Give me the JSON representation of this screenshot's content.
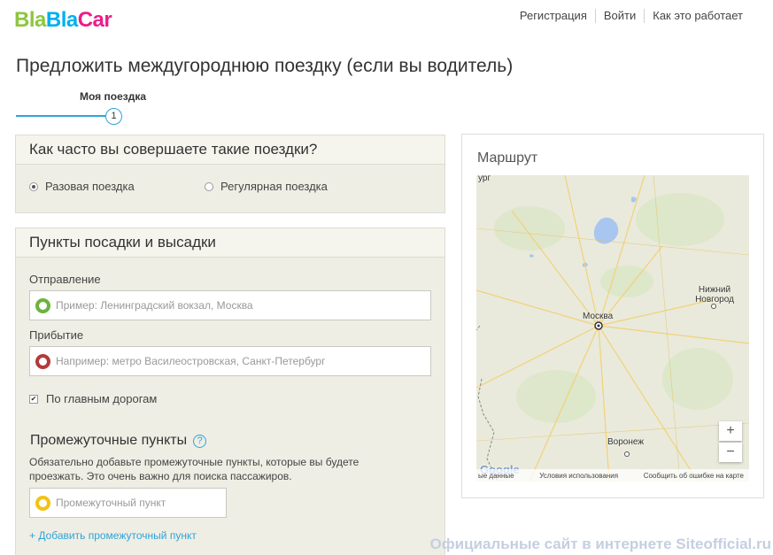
{
  "logo": {
    "part1": "Bla",
    "part2": "Bla",
    "part3": "Car"
  },
  "nav": {
    "register": "Регистрация",
    "login": "Войти",
    "how": "Как это работает"
  },
  "page_title": "Предложить междугороднюю поездку (если вы водитель)",
  "step": {
    "label": "Моя поездка",
    "number": "1"
  },
  "frequency": {
    "title": "Как часто вы совершаете такие поездки?",
    "option_single": "Разовая поездка",
    "option_regular": "Регулярная поездка",
    "selected": "Разовая поездка"
  },
  "points": {
    "title": "Пункты посадки и высадки",
    "departure_label": "Отправление",
    "departure_placeholder": "Пример: Ленинградский вокзал, Москва",
    "departure_value": "",
    "arrival_label": "Прибытие",
    "arrival_placeholder": "Например: метро Василеостровская, Санкт-Петербург",
    "arrival_value": "",
    "main_roads_label": "По главным дорогам",
    "main_roads_checked": true,
    "intermediate_title": "Промежуточные пункты",
    "intermediate_help": "?",
    "intermediate_note": "Обязательно добавьте промежуточные пункты, которые вы будете проезжать. Это очень важно для поиска пассажиров.",
    "intermediate_placeholder": "Промежуточный пункт",
    "intermediate_value": "",
    "add_intermediate": "+ Добавить промежуточный пункт"
  },
  "map": {
    "title": "Маршрут",
    "cities": [
      "Москва",
      "Нижний Новгород",
      "Воронеж"
    ],
    "zoom_in": "+",
    "zoom_out": "−",
    "footer_data": "ые данные",
    "footer_terms": "Условия использования",
    "footer_report": "Сообщить об ошибке на карте",
    "brand": "Google",
    "top_label": "ург"
  },
  "watermark": "Официальные сайт в интернете Siteofficial.ru",
  "colors": {
    "accent": "#30a3d8",
    "green": "#6cb33f",
    "red": "#b33a3a",
    "yellow": "#f3c313"
  }
}
